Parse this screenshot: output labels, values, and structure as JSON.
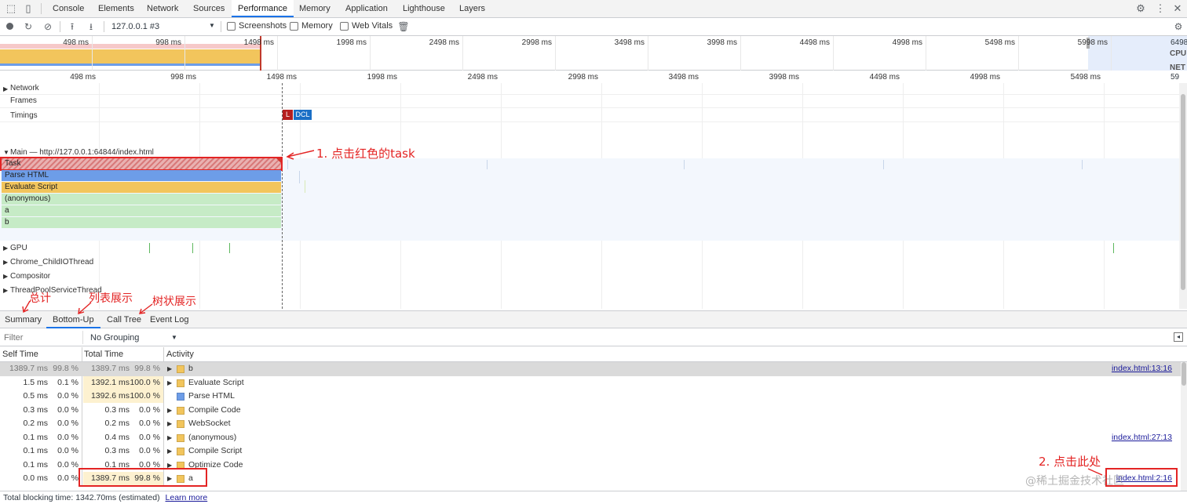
{
  "tabs": [
    "Console",
    "Elements",
    "Network",
    "Sources",
    "Performance",
    "Memory",
    "Application",
    "Lighthouse",
    "Layers"
  ],
  "active_tab": "Performance",
  "toolbar": {
    "url_select": "127.0.0.1 #3",
    "screenshots_label": "Screenshots",
    "memory_label": "Memory",
    "webvitals_label": "Web Vitals"
  },
  "overview": {
    "ticks": [
      "498 ms",
      "998 ms",
      "1498 ms",
      "1998 ms",
      "2498 ms",
      "2998 ms",
      "3498 ms",
      "3998 ms",
      "4498 ms",
      "4998 ms",
      "5498 ms",
      "5998 ms",
      "6498"
    ],
    "cpu_label": "CPU",
    "net_label": "NET"
  },
  "ruler_ticks": [
    "498 ms",
    "998 ms",
    "1498 ms",
    "1998 ms",
    "2498 ms",
    "2998 ms",
    "3498 ms",
    "3998 ms",
    "4498 ms",
    "4998 ms",
    "5498 ms",
    "59"
  ],
  "tracks": {
    "network": "Network",
    "frames": "Frames",
    "timings": "Timings",
    "marker_l": "L",
    "marker_dcl": "DCL",
    "main": "Main — http://127.0.0.1:64844/index.html",
    "gpu": "GPU",
    "child_io": "Chrome_ChildIOThread",
    "compositor": "Compositor",
    "threadpool": "ThreadPoolServiceThread"
  },
  "flame": [
    "Task",
    "Parse HTML",
    "Evaluate Script",
    "(anonymous)",
    "a",
    "b"
  ],
  "bottom_tabs": [
    "Summary",
    "Bottom-Up",
    "Call Tree",
    "Event Log"
  ],
  "active_bottom_tab": "Bottom-Up",
  "filter": {
    "placeholder": "Filter",
    "grouping": "No Grouping"
  },
  "columns": {
    "self": "Self Time",
    "total": "Total Time",
    "activity": "Activity"
  },
  "rows": [
    {
      "self_ms": "1389.7 ms",
      "self_pct": "99.8 %",
      "total_ms": "1389.7 ms",
      "total_pct": "99.8 %",
      "activity": "b",
      "color": "#f2c55c",
      "link": "index.html:13:16",
      "expand": true
    },
    {
      "self_ms": "1.5 ms",
      "self_pct": "0.1 %",
      "total_ms": "1392.1 ms",
      "total_pct": "100.0 %",
      "activity": "Evaluate Script",
      "color": "#f2c55c",
      "link": "",
      "expand": true
    },
    {
      "self_ms": "0.5 ms",
      "self_pct": "0.0 %",
      "total_ms": "1392.6 ms",
      "total_pct": "100.0 %",
      "activity": "Parse HTML",
      "color": "#6d9de8",
      "link": "",
      "expand": false
    },
    {
      "self_ms": "0.3 ms",
      "self_pct": "0.0 %",
      "total_ms": "0.3 ms",
      "total_pct": "0.0 %",
      "activity": "Compile Code",
      "color": "#f2c55c",
      "link": "",
      "expand": true
    },
    {
      "self_ms": "0.2 ms",
      "self_pct": "0.0 %",
      "total_ms": "0.2 ms",
      "total_pct": "0.0 %",
      "activity": "WebSocket",
      "color": "#f2c55c",
      "link": "",
      "expand": true
    },
    {
      "self_ms": "0.1 ms",
      "self_pct": "0.0 %",
      "total_ms": "0.4 ms",
      "total_pct": "0.0 %",
      "activity": "(anonymous)",
      "color": "#f2c55c",
      "link": "index.html:27:13",
      "expand": true
    },
    {
      "self_ms": "0.1 ms",
      "self_pct": "0.0 %",
      "total_ms": "0.3 ms",
      "total_pct": "0.0 %",
      "activity": "Compile Script",
      "color": "#f2c55c",
      "link": "",
      "expand": true
    },
    {
      "self_ms": "0.1 ms",
      "self_pct": "0.0 %",
      "total_ms": "0.1 ms",
      "total_pct": "0.0 %",
      "activity": "Optimize Code",
      "color": "#f2c55c",
      "link": "",
      "expand": true
    },
    {
      "self_ms": "0.0 ms",
      "self_pct": "0.0 %",
      "total_ms": "1389.7 ms",
      "total_pct": "99.8 %",
      "activity": "a",
      "color": "#f2c55c",
      "link": "index.html:2:16",
      "expand": true
    }
  ],
  "status": {
    "text": "Total blocking time: 1342.70ms (estimated)",
    "link": "Learn more"
  },
  "annotations": {
    "a1": "1. 点击红色的task",
    "a2": "2. 点击此处",
    "summary": "总计",
    "list": "列表展示",
    "tree": "树状展示",
    "watermark": "@稀土掘金技术社区"
  },
  "colors": {
    "accent": "#1a73e8",
    "task_red": "#d0352c",
    "annotation_red": "#e32424"
  }
}
